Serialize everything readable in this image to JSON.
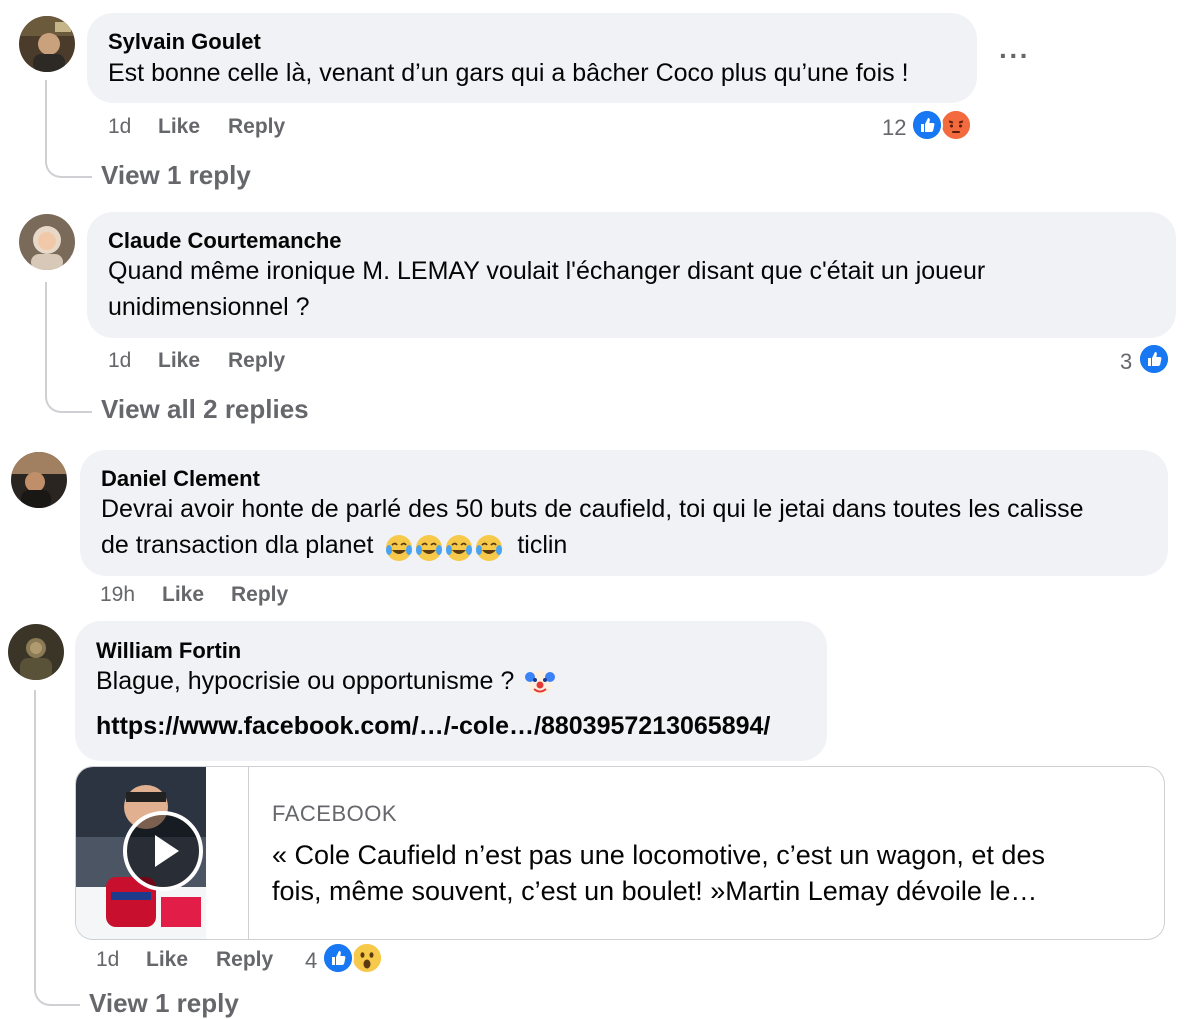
{
  "comments": [
    {
      "author": "Sylvain Goulet",
      "text": "Est bonne celle là, venant d’un gars qui a bâcher Coco plus qu’une fois !",
      "time": "1d",
      "like": "Like",
      "reply": "Reply",
      "reaction_count": "12",
      "reactions": [
        "like-icon",
        "angry-icon"
      ],
      "more": "···",
      "view_replies": "View 1 reply"
    },
    {
      "author": "Claude Courtemanche",
      "text_line1": "Quand même ironique M. LEMAY voulait l'échanger disant que c'était un joueur",
      "text_line2": "unidimensionnel ?",
      "time": "1d",
      "like": "Like",
      "reply": "Reply",
      "reaction_count": "3",
      "reactions": [
        "like-icon"
      ],
      "view_replies": "View all 2 replies"
    },
    {
      "author": "Daniel Clement",
      "text_line1": "Devrai avoir honte de parlé des 50 buts de caufield, toi qui le jetai dans toutes les calisse",
      "text_line2_a": "de transaction dla planet",
      "text_line2_b": "ticlin",
      "emojis": [
        "laughing-tears-icon",
        "laughing-tears-icon",
        "laughing-tears-icon",
        "laughing-tears-icon"
      ],
      "time": "19h",
      "like": "Like",
      "reply": "Reply"
    },
    {
      "author": "William Fortin",
      "text": "Blague, hypocrisie ou opportunisme ?",
      "emoji": "clown-face-icon",
      "link": "https://www.facebook.com/…/-cole…/8803957213065894/",
      "card": {
        "source": "FACEBOOK",
        "title_line1": "« Cole Caufield n’est pas une locomotive, c’est un wagon, et des",
        "title_line2": "fois, même souvent, c’est un boulet! »Martin Lemay dévoile le…",
        "thumbnail": "video-thumbnail-hockey",
        "play_icon": "play-icon"
      },
      "time": "1d",
      "like": "Like",
      "reply": "Reply",
      "reaction_count": "4",
      "reactions": [
        "like-icon",
        "wow-icon"
      ],
      "view_replies": "View 1 reply"
    }
  ],
  "colors": {
    "bubble": "#f0f2f5",
    "meta_text": "#65676b",
    "like_blue": "#1877f2",
    "thread_line": "#ced0d4"
  }
}
